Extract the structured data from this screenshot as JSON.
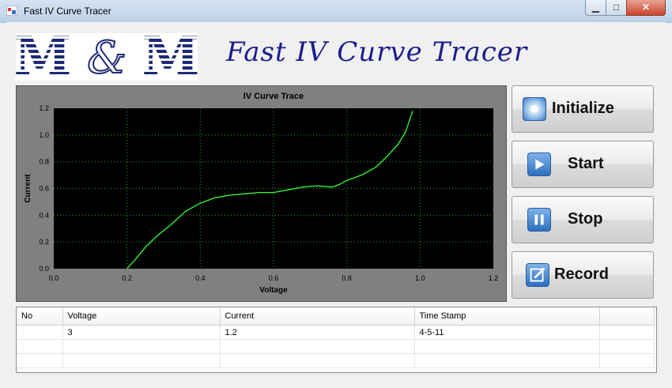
{
  "window": {
    "title": "Fast IV Curve Tracer",
    "min": "▁",
    "max": "□",
    "close": "✕"
  },
  "logo": {
    "text": "M & M"
  },
  "app_title": "Fast IV Curve Tracer",
  "buttons": {
    "initialize": "Initialize",
    "start": "Start",
    "stop": "Stop",
    "record": "Record"
  },
  "table": {
    "headers": [
      "No",
      "Voltage",
      "Current",
      "Time Stamp"
    ],
    "rows": [
      [
        "",
        "3",
        "1.2",
        "4-5-11"
      ],
      [
        "",
        "",
        "",
        ""
      ],
      [
        "",
        "",
        "",
        ""
      ]
    ]
  },
  "chart_data": {
    "type": "line",
    "title": "IV Curve Trace",
    "xlabel": "Voltage",
    "ylabel": "Current",
    "xlim": [
      0,
      1.2
    ],
    "ylim": [
      0,
      1.2
    ],
    "xticks": [
      "0.0",
      "0.2",
      "0.4",
      "0.6",
      "0.8",
      "1.0",
      "1.2"
    ],
    "yticks": [
      "0.0",
      "0.2",
      "0.4",
      "0.6",
      "0.8",
      "1.0",
      "1.2"
    ],
    "grid": true,
    "colors": {
      "plot_bg": "#000000",
      "panel_bg": "#808080",
      "line": "#33ff33",
      "grid": "#2e9e2e"
    },
    "series": [
      {
        "x": [
          0.2,
          0.22,
          0.25,
          0.28,
          0.32,
          0.36,
          0.4,
          0.44,
          0.48,
          0.52,
          0.56,
          0.6,
          0.64,
          0.68,
          0.72,
          0.76,
          0.78,
          0.8,
          0.84,
          0.88,
          0.91,
          0.94,
          0.96,
          0.97,
          0.98
        ],
        "y": [
          0.0,
          0.06,
          0.16,
          0.24,
          0.33,
          0.43,
          0.49,
          0.53,
          0.55,
          0.56,
          0.57,
          0.57,
          0.59,
          0.61,
          0.62,
          0.61,
          0.63,
          0.66,
          0.7,
          0.76,
          0.84,
          0.93,
          1.02,
          1.1,
          1.18
        ]
      }
    ]
  }
}
